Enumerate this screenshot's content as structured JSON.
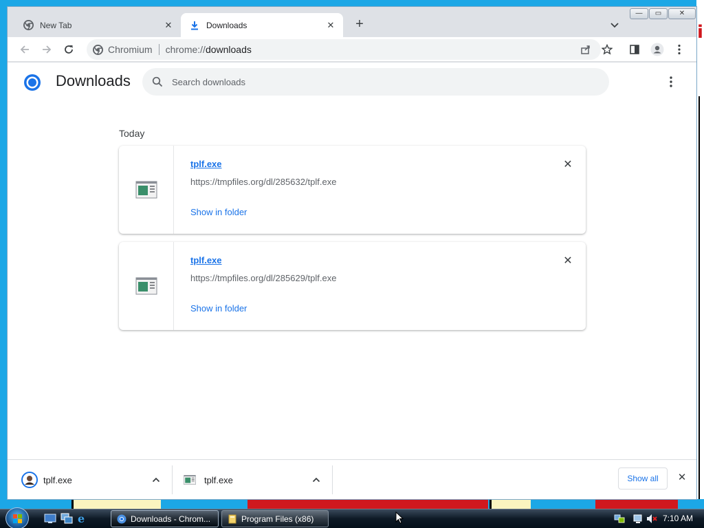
{
  "browser": {
    "tabs": [
      {
        "title": "New Tab",
        "icon": "chromium-icon",
        "active": false
      },
      {
        "title": "Downloads",
        "icon": "download-icon",
        "active": true
      }
    ],
    "window_controls": {
      "minimize": "—",
      "maximize": "▭",
      "close": "✕"
    }
  },
  "omnibox": {
    "site_name": "Chromium",
    "url_scheme": "chrome://",
    "url_path": "downloads"
  },
  "downloads_page": {
    "title": "Downloads",
    "search_placeholder": "Search downloads",
    "section_label": "Today",
    "items": [
      {
        "file_name": "tplf.exe",
        "url": "https://tmpfiles.org/dl/285632/tplf.exe",
        "action": "Show in folder"
      },
      {
        "file_name": "tplf.exe",
        "url": "https://tmpfiles.org/dl/285629/tplf.exe",
        "action": "Show in folder"
      }
    ]
  },
  "download_shelf": {
    "items": [
      {
        "file_name": "tplf.exe"
      },
      {
        "file_name": "tplf.exe"
      }
    ],
    "show_all_label": "Show all"
  },
  "taskbar": {
    "tasks": [
      {
        "label": "Downloads - Chrom..."
      },
      {
        "label": "Program Files (x86)"
      }
    ],
    "clock": "7:10 AM"
  },
  "colors": {
    "accent": "#1a73e8",
    "desktop": "#1ca7e6",
    "tab_strip": "#dee1e6"
  }
}
